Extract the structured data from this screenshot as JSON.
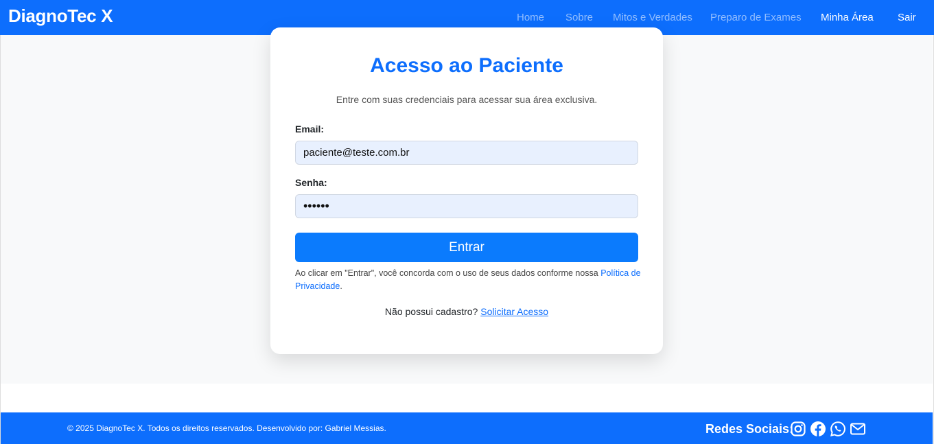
{
  "brand": "DiagnoTec X",
  "nav": {
    "home": "Home",
    "about": "Sobre",
    "myths": "Mitos e Verdades",
    "prep": "Preparo de Exames",
    "area": "Minha Área",
    "logout": "Sair"
  },
  "login": {
    "title": "Acesso ao Paciente",
    "subtitle": "Entre com suas credenciais para acessar sua área exclusiva.",
    "email_label": "Email:",
    "email_value": "paciente@teste.com.br",
    "password_label": "Senha:",
    "password_value": "••••••",
    "submit": "Entrar",
    "terms_text": "Ao clicar em \"Entrar\", você concorda com o uso de seus dados conforme nossa ",
    "privacy_link": "Política de Privacidade",
    "terms_end": ".",
    "signup_text": "Não possui cadastro? ",
    "signup_link": "Solicitar Acesso"
  },
  "footer": {
    "copyright": "© 2025 DiagnoTec X. Todos os direitos reservados. Desenvolvido por: Gabriel Messias.",
    "social_label": "Redes Sociais:",
    "icons": [
      "instagram-icon",
      "facebook-icon",
      "whatsapp-icon",
      "email-icon"
    ]
  },
  "colors": {
    "primary": "#0d6efd",
    "button": "#0b7bfd",
    "input_bg": "#e8f0fe",
    "page_bg": "#f8f9fa"
  }
}
